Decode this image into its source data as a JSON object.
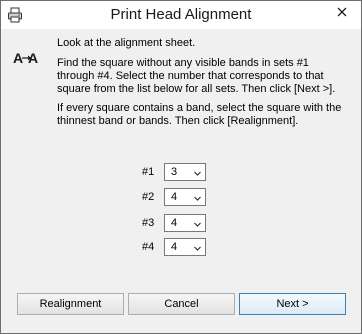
{
  "window": {
    "title": "Print Head Alignment"
  },
  "instructions": {
    "line1": "Look at the alignment sheet.",
    "line2": "Find the square without any visible bands in sets #1 through #4. Select the number that corresponds to that square from the list below for all sets. Then click [Next >].",
    "line3": "If every square contains a band, select the square with the thinnest band or bands. Then click [Realignment]."
  },
  "sets": [
    {
      "label": "#1",
      "value": "3"
    },
    {
      "label": "#2",
      "value": "4"
    },
    {
      "label": "#3",
      "value": "4"
    },
    {
      "label": "#4",
      "value": "4"
    }
  ],
  "buttons": {
    "realignment": "Realignment",
    "cancel": "Cancel",
    "next": "Next >"
  },
  "icons": {
    "app": "printer-icon",
    "close": "close-icon",
    "logo": "alignment-icon",
    "dropdown": "chevron-down-icon"
  }
}
